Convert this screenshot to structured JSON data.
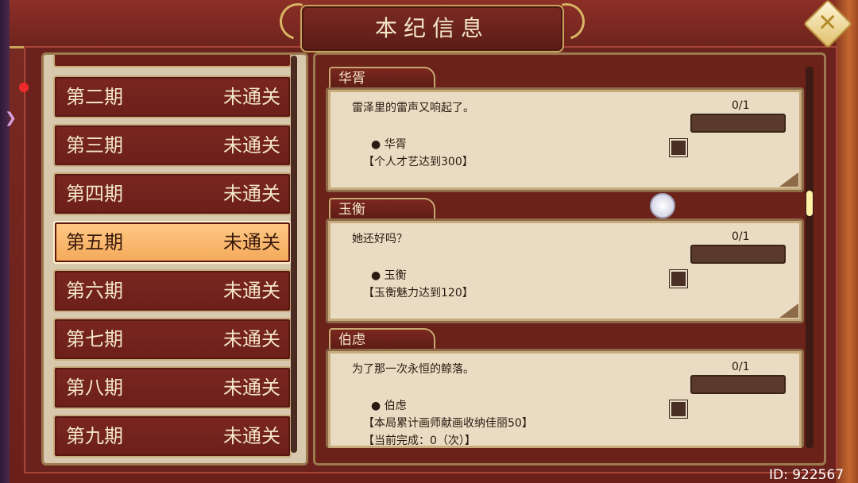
{
  "title": "本纪信息",
  "close_icon": "close-x-icon",
  "periods": [
    {
      "name": "第二期",
      "status": "未通关"
    },
    {
      "name": "第三期",
      "status": "未通关"
    },
    {
      "name": "第四期",
      "status": "未通关"
    },
    {
      "name": "第五期",
      "status": "未通关",
      "active": true
    },
    {
      "name": "第六期",
      "status": "未通关"
    },
    {
      "name": "第七期",
      "status": "未通关"
    },
    {
      "name": "第八期",
      "status": "未通关"
    },
    {
      "name": "第九期",
      "status": "未通关"
    }
  ],
  "quests": [
    {
      "tab": "华胥",
      "desc": "雷泽里的雷声又响起了。",
      "progress": "0/1",
      "character": "● 华胥",
      "requirement": "【个人才艺达到300】"
    },
    {
      "tab": "玉衡",
      "desc": "她还好吗？",
      "progress": "0/1",
      "character": "● 玉衡",
      "requirement": "【玉衡魅力达到120】"
    },
    {
      "tab": "伯虑",
      "desc": "为了那一次永恒的鲸落。",
      "progress": "0/1",
      "character": "● 伯虑",
      "requirement": "【本局累计画师献画收纳佳丽50】",
      "requirement2": "【当前完成：0（次）】"
    }
  ],
  "footer_id": "ID: 922567",
  "colors": {
    "frame": "#6b221c",
    "active_item": "#f4a95a",
    "item": "#7a2620",
    "card": "#eadcc2"
  }
}
